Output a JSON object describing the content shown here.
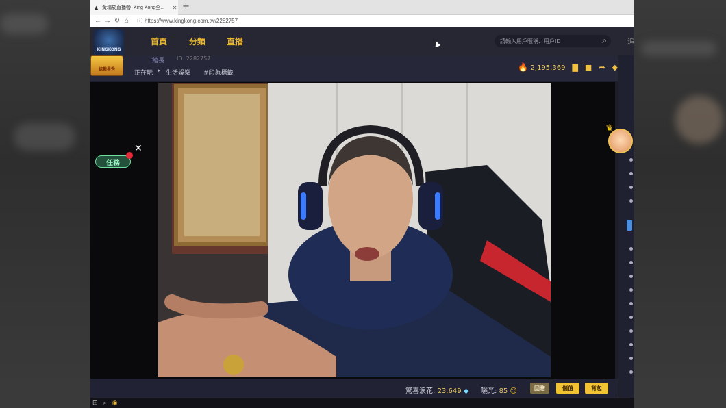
{
  "browser": {
    "tab_title": "黃埔於直播營_King Kong全...",
    "new_tab_label": "+",
    "url": "https://www.kingkong.com.tw/2282757"
  },
  "site": {
    "logo_text": "KINGKONG",
    "nav": [
      "首頁",
      "分類",
      "直播"
    ],
    "search_placeholder": "請輸入用戶暱稱、用戶ID",
    "header_right": "追"
  },
  "stream": {
    "badge_text": "綜藝星秀",
    "streamer_name": "館長",
    "room_id": "ID: 2282757",
    "playing_label": "正在玩",
    "category": "生活娛樂",
    "tag": "#印象標籤",
    "hot_value": "2,195,369"
  },
  "overlay": {
    "task_label": "任務",
    "task_close": "✕"
  },
  "bottom": {
    "gift_label": "驚喜浪花:",
    "gift_value": "23,649",
    "glow_label": "曬光:",
    "glow_value": "85",
    "buttons": [
      "回贈",
      "儲值",
      "背包"
    ]
  },
  "colors": {
    "accent": "#e8b530",
    "header_bg": "#262733",
    "info_bg": "#26283a",
    "button_bg": "#f1c232"
  }
}
